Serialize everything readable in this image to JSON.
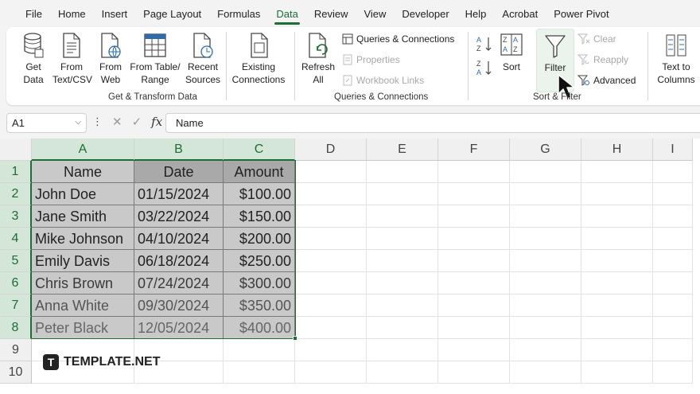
{
  "menu": [
    "File",
    "Home",
    "Insert",
    "Page Layout",
    "Formulas",
    "Data",
    "Review",
    "View",
    "Developer",
    "Help",
    "Acrobat",
    "Power Pivot"
  ],
  "ribbon": {
    "get_data": "Get Data",
    "from_text": "From Text/CSV",
    "from_web": "From Web",
    "from_table": "From Table/ Range",
    "recent_sources": "Recent Sources",
    "existing_connections": "Existing Connections",
    "group_get_transform": "Get & Transform Data",
    "refresh_all": "Refresh All",
    "queries_connections": "Queries & Connections",
    "properties": "Properties",
    "workbook_links": "Workbook Links",
    "group_queries": "Queries & Connections",
    "sort": "Sort",
    "filter": "Filter",
    "clear": "Clear",
    "reapply": "Reapply",
    "advanced": "Advanced",
    "group_sort_filter": "Sort & Filter",
    "text_to_columns": "Text to Columns"
  },
  "formula_bar": {
    "name_box": "A1",
    "fx": "fx",
    "value": "Name"
  },
  "columns": [
    "A",
    "B",
    "C",
    "D",
    "E",
    "F",
    "G",
    "H",
    "I"
  ],
  "rows": [
    "1",
    "2",
    "3",
    "4",
    "5",
    "6",
    "7",
    "8",
    "9",
    "10"
  ],
  "table": {
    "headers": [
      "Name",
      "Date",
      "Amount"
    ],
    "rows": [
      [
        "John Doe",
        "01/15/2024",
        "$100.00"
      ],
      [
        "Jane Smith",
        "03/22/2024",
        "$150.00"
      ],
      [
        "Mike Johnson",
        "04/10/2024",
        "$200.00"
      ],
      [
        "Emily Davis",
        "06/18/2024",
        "$250.00"
      ],
      [
        "Chris Brown",
        "07/24/2024",
        "$300.00"
      ],
      [
        "Anna White",
        "09/30/2024",
        "$350.00"
      ],
      [
        "Peter Black",
        "12/05/2024",
        "$400.00"
      ]
    ]
  },
  "watermark": "TEMPLATE.NET",
  "colors": {
    "accent": "#1b6e34",
    "selection_fill": "#c9c9c9"
  }
}
